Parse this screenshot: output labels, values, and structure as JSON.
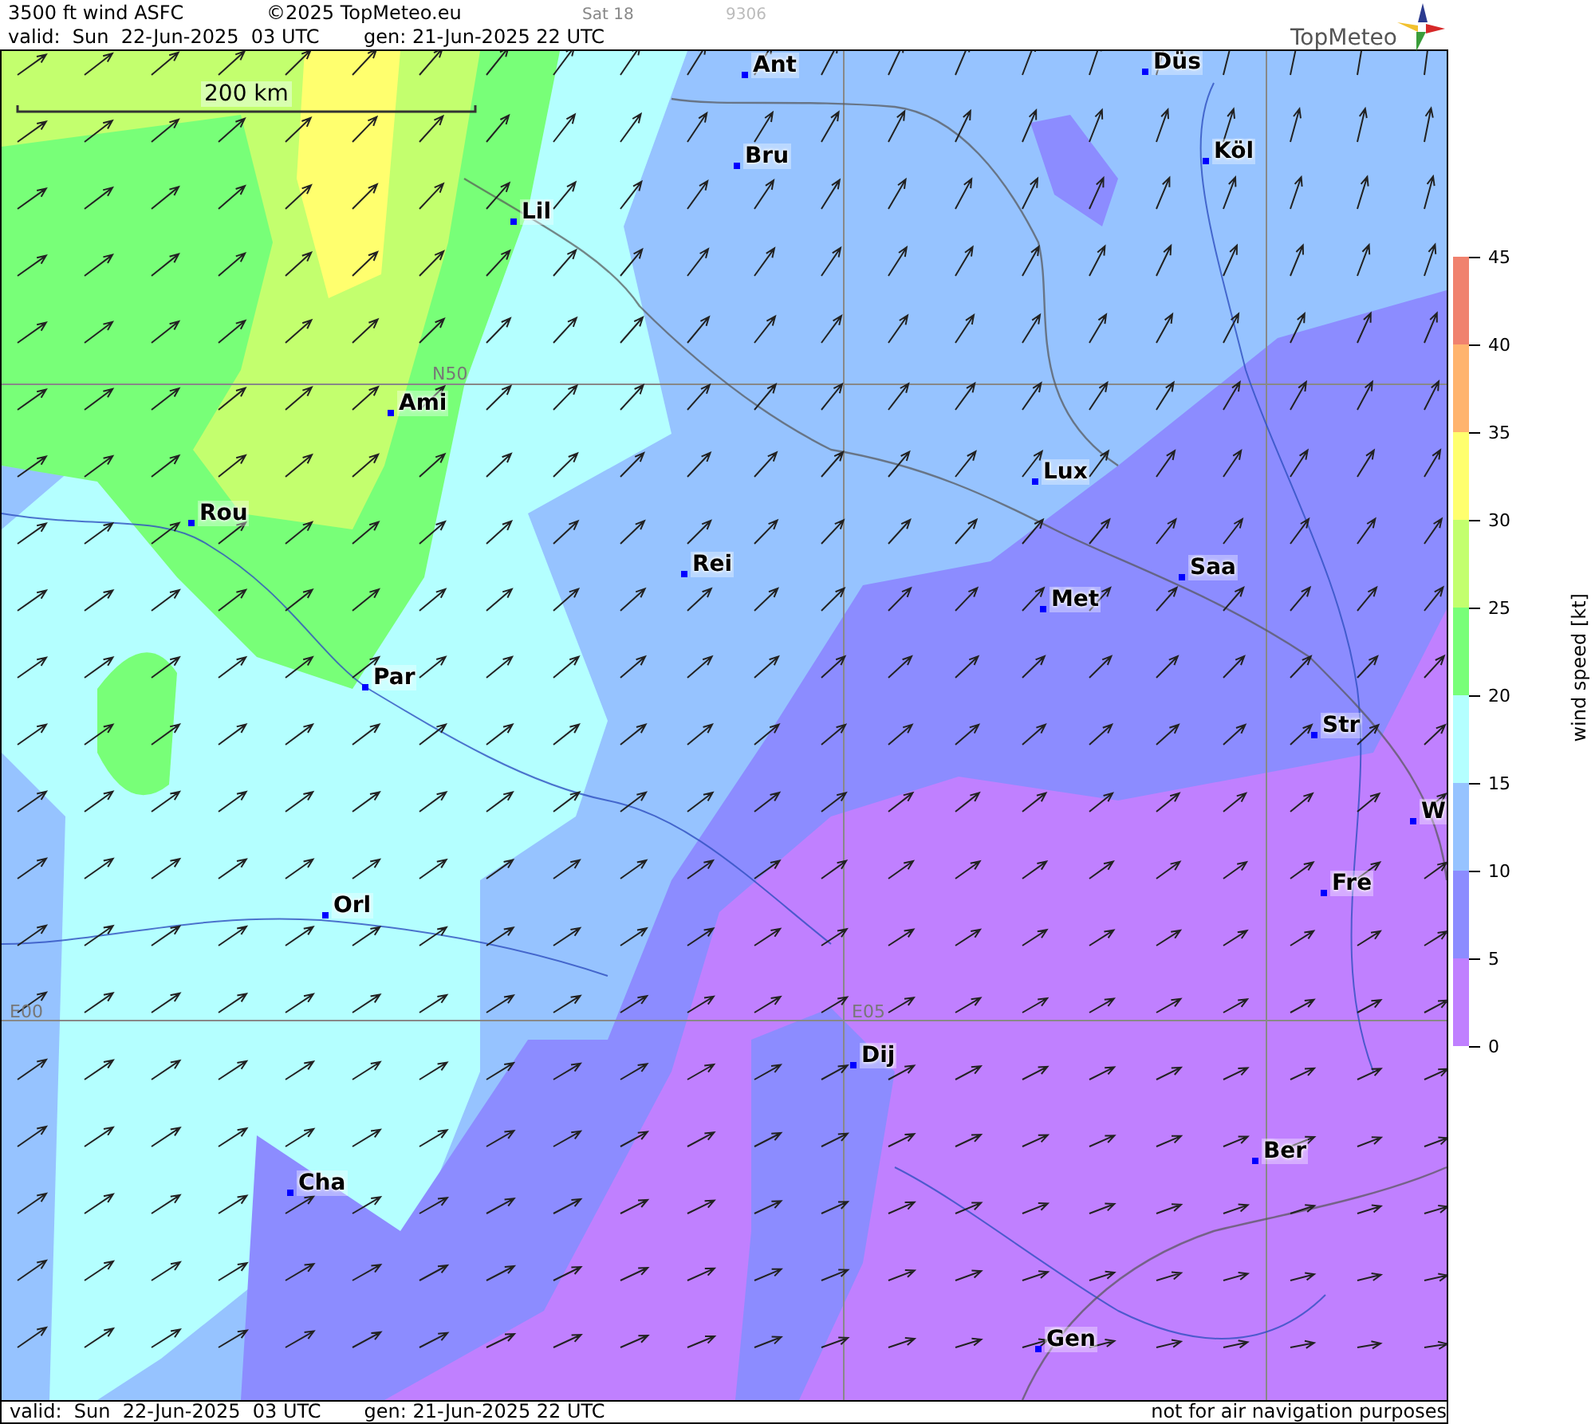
{
  "header": {
    "product": "3500 ft wind ASFC",
    "copyright": "©2025 TopMeteo.eu",
    "slot": "Sat 18",
    "code": "9306",
    "valid": "valid:  Sun  22-Jun-2025  03 UTC",
    "generated": "gen: 21-Jun-2025 22 UTC",
    "logo": "TopMeteo"
  },
  "map": {
    "scale": "200 km",
    "grid_labels": [
      "N50",
      "E00",
      "E05"
    ],
    "cities": [
      "Ant",
      "Düs",
      "Bru",
      "Köl",
      "Lil",
      "Ami",
      "Lux",
      "Rou",
      "Rei",
      "Saa",
      "Met",
      "Par",
      "Str",
      "W",
      "Fre",
      "Orl",
      "Dij",
      "Cha",
      "Ber",
      "Gen"
    ]
  },
  "legend": {
    "title": "wind speed [kt]",
    "ticks": [
      "45",
      "40",
      "35",
      "30",
      "25",
      "20",
      "15",
      "10",
      "5",
      "0"
    ],
    "bands": [
      {
        "color": "#f0826e"
      },
      {
        "color": "#ffb46e"
      },
      {
        "color": "#ffff6e"
      },
      {
        "color": "#c3ff6e"
      },
      {
        "color": "#78ff78"
      },
      {
        "color": "#b4ffff"
      },
      {
        "color": "#96c3ff"
      },
      {
        "color": "#8c8cff"
      },
      {
        "color": "#c080ff"
      }
    ]
  },
  "footer": {
    "valid": "valid:  Sun  22-Jun-2025  03 UTC",
    "generated": "gen: 21-Jun-2025 22 UTC",
    "notice": "not for air navigation purposes"
  }
}
